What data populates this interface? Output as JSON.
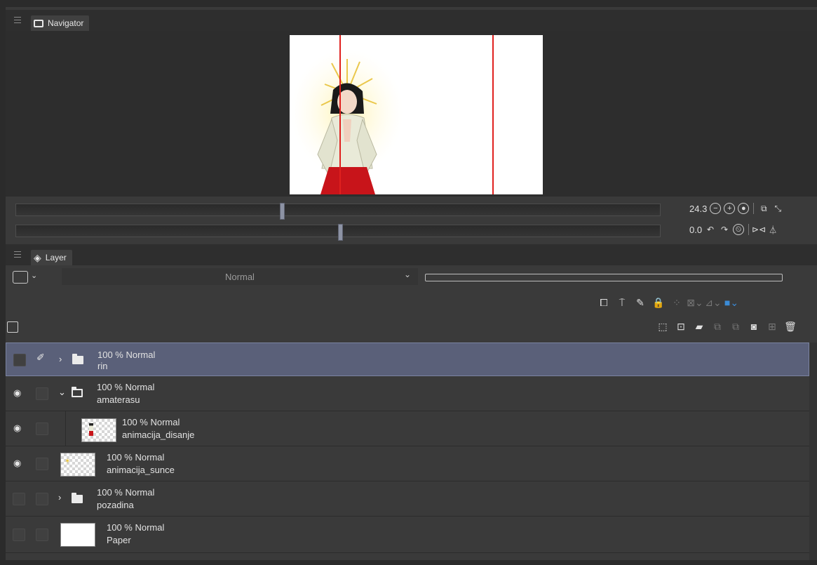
{
  "navigator": {
    "tab_label": "Navigator",
    "zoom_value": "24.3",
    "rotate_value": "0.0",
    "zoom_slider_level": 0.41,
    "rotate_slider_level": 0.5
  },
  "layer_panel": {
    "tab_label": "Layer",
    "blend_mode": "Normal"
  },
  "layers": [
    {
      "opacity_mode": "100 % Normal",
      "name": "rin",
      "type": "folder",
      "expanded": false,
      "visible": false,
      "selected": true
    },
    {
      "opacity_mode": "100 % Normal",
      "name": "amaterasu",
      "type": "folder",
      "expanded": true,
      "visible": true,
      "selected": false
    },
    {
      "opacity_mode": "100 % Normal",
      "name": "animacija_disanje",
      "type": "raster",
      "visible": true,
      "selected": false
    },
    {
      "opacity_mode": "100 % Normal",
      "name": "animacija_sunce",
      "type": "raster",
      "visible": true,
      "selected": false
    },
    {
      "opacity_mode": "100 % Normal",
      "name": "pozadina",
      "type": "folder",
      "expanded": false,
      "visible": false,
      "selected": false
    },
    {
      "opacity_mode": "100 % Normal",
      "name": "Paper",
      "type": "paper",
      "visible": false,
      "selected": false
    }
  ],
  "colors": {
    "selected_row": "#5a6079",
    "guide_line": "#e0201e",
    "panel_bg": "#3a3a3a"
  }
}
